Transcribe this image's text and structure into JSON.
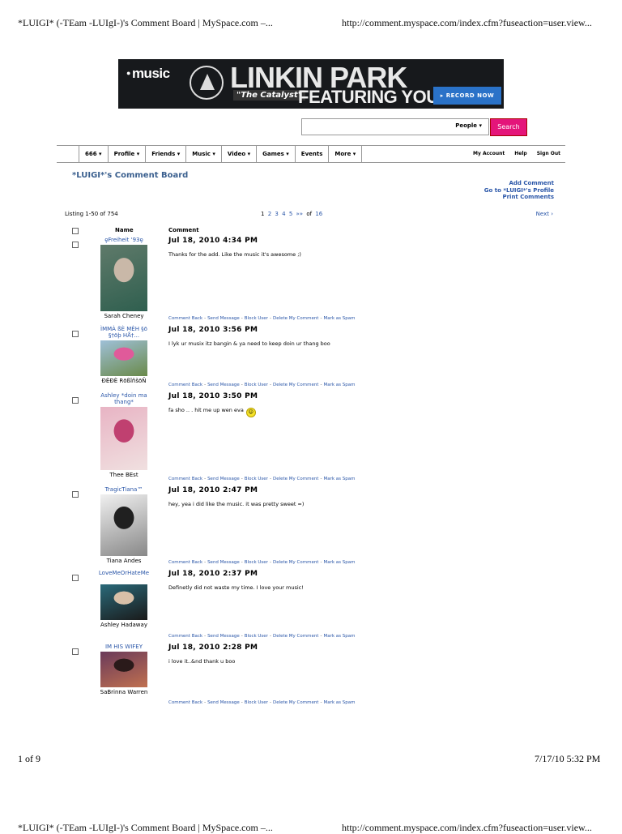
{
  "print_header": {
    "title": "*LUIGI* (-TEam -LUIgI-)'s Comment Board | MySpace.com –...",
    "url": "http://comment.myspace.com/index.cfm?fuseaction=user.view..."
  },
  "ad": {
    "brand": "music",
    "band": "LINKIN PARK",
    "song": "\"The Catalyst\"",
    "tagline": "FEATURING YOU",
    "cta": "▸ RECORD NOW"
  },
  "search": {
    "value": "",
    "scope": "People ▾",
    "button": "Search"
  },
  "nav": {
    "items": [
      "666 ▾",
      "Profile ▾",
      "Friends ▾",
      "Music ▾",
      "Video ▾",
      "Games ▾",
      "Events",
      "More ▾"
    ],
    "right": [
      "My Account",
      "Help",
      "Sign Out"
    ]
  },
  "board": {
    "title": "*LUIGI*'s Comment Board",
    "links": [
      "Add Comment",
      "Go to *LUIGI*'s Profile",
      "Print Comments"
    ],
    "listing": "Listing 1-50 of 754",
    "pages": [
      "1",
      "2",
      "3",
      "4",
      "5",
      "»»"
    ],
    "of_label": "of",
    "total_pages": "16",
    "next": "Next ›",
    "col_name": "Name",
    "col_comment": "Comment"
  },
  "actions": [
    "Comment Back",
    "Send Message",
    "Block User",
    "Delete My Comment",
    "Mark as Spam"
  ],
  "comments": [
    {
      "name": "ȩFreiheit '93ȩ",
      "real": "Sarah Cheney",
      "date": "Jul 18, 2010 4:34 PM",
      "text": "Thanks for the add. Like the music it's awesome ;)"
    },
    {
      "name": "ÌMMÀ ßÈ MÈH §ō §†ōþ HÅ†...",
      "real": "ÐÈÐÈ RōßîñšōÑ",
      "date": "Jul 18, 2010 3:56 PM",
      "text": "I lyk ur musix itz bangin & ya need to keep doin ur thang boo"
    },
    {
      "name": "Ashley *doin ma thang*",
      "real": "Thee BEst",
      "date": "Jul 18, 2010 3:50 PM",
      "text": "fa sho .. . hit me up wen eva"
    },
    {
      "name": "TragicTiana™",
      "real": "Tiana Andes",
      "date": "Jul 18, 2010 2:47 PM",
      "text": "hey, yea i did like the music. it was pretty sweet =)"
    },
    {
      "name": "LoveMeOrHateMe",
      "real": "Ashley Hadaway",
      "date": "Jul 18, 2010 2:37 PM",
      "text": "Definetly did not waste my time. I love your music!"
    },
    {
      "name": "IM HIS WIFEY",
      "real": "SaBrinna Warren",
      "date": "Jul 18, 2010 2:28 PM",
      "text": "i love it..&nd thank u boo"
    }
  ],
  "footer": {
    "page": "1 of 9",
    "datetime": "7/17/10 5:32 PM"
  }
}
